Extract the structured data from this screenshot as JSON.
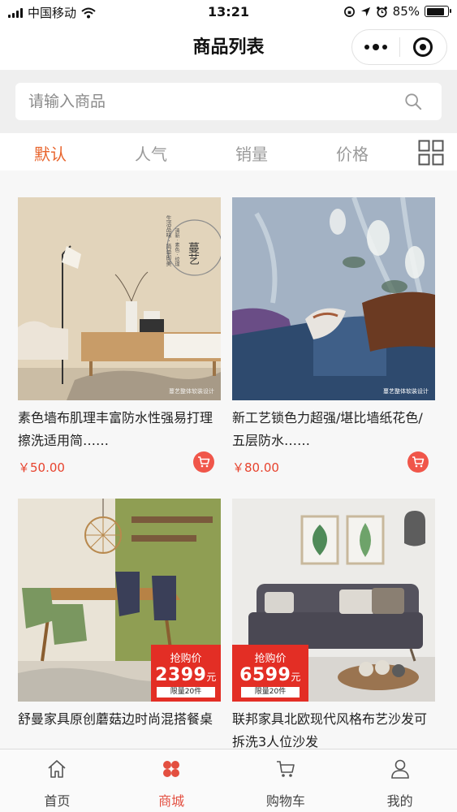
{
  "status_bar": {
    "carrier": "中国移动",
    "time": "13:21",
    "battery": "85%",
    "battery_level": 0.85
  },
  "nav": {
    "title": "商品列表"
  },
  "search": {
    "placeholder": "请输入商品"
  },
  "sort_tabs": [
    {
      "label": "默认",
      "active": true
    },
    {
      "label": "人气",
      "active": false
    },
    {
      "label": "销量",
      "active": false
    },
    {
      "label": "价格",
      "active": false
    }
  ],
  "products": [
    {
      "name": "素色墙布肌理丰富防水性强易打理擦洗适用简……",
      "price": "￥50.00",
      "image_text": [
        "蔓艺",
        "生活品味 · 简单即美",
        "清新 · 素色 · 纹理"
      ],
      "watermark": "蔓艺整体软装设计"
    },
    {
      "name": "新工艺锁色力超强/堪比墙纸花色/五层防水……",
      "price": "￥80.00",
      "watermark": "蔓艺整体软装设计"
    },
    {
      "name": "舒曼家具原创蘑菇边时尚混搭餐桌",
      "promo": {
        "tag": "抢购价",
        "price": "2399",
        "unit": "元",
        "limit": "限量20件"
      }
    },
    {
      "name": "联邦家具北欧现代风格布艺沙发可拆洗3人位沙发",
      "promo": {
        "tag": "抢购价",
        "price": "6599",
        "unit": "元",
        "limit": "限量20件"
      }
    }
  ],
  "tab_bar": [
    {
      "label": "首页",
      "icon": "home-icon",
      "active": false
    },
    {
      "label": "商城",
      "icon": "mall-icon",
      "active": true
    },
    {
      "label": "购物车",
      "icon": "cart-icon",
      "active": false
    },
    {
      "label": "我的",
      "icon": "user-icon",
      "active": false
    }
  ],
  "colors": {
    "accent": "#e8642c",
    "price": "#e7432e",
    "cart_button": "#f0564a",
    "promo": "#e32e25",
    "tab_active": "#e34f40"
  }
}
